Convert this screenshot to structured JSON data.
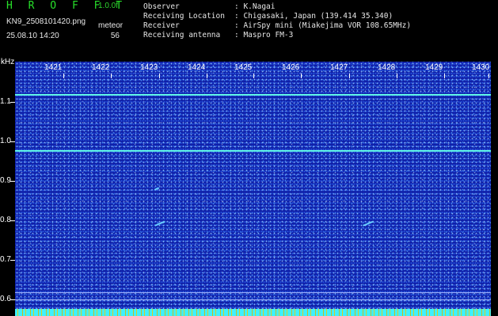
{
  "header": {
    "app_title": "H R O F F T",
    "version": "1.0.0f",
    "filename": "KN9_2508101420.png",
    "meteor_label": "meteor",
    "datetime": "25.08.10 14:20",
    "meteor_count": "56"
  },
  "info": {
    "observer_label": "Observer",
    "observer_value": ": K.Nagai",
    "location_label": "Receiving Location",
    "location_value": ": Chigasaki, Japan (139.414 35.340)",
    "receiver_label": "Receiver",
    "receiver_value": ": AirSpy mini (Miakejima VOR 108.65MHz)",
    "antenna_label": "Receiving antenna",
    "antenna_value": ": Maspro FM-3"
  },
  "spectrogram": {
    "y_unit": "kHz",
    "x_ticks": [
      "1421",
      "1422",
      "1423",
      "1424",
      "1425",
      "1426",
      "1427",
      "1428",
      "1429",
      "1430"
    ],
    "y_ticks": [
      "1.1",
      "1.0",
      "0.9",
      "0.8",
      "0.7",
      "0.6"
    ],
    "colors": {
      "background": "#1020a8",
      "carrier_line": "#5ff5e6",
      "bottom_band": "#3ff0ff",
      "title_green": "#27e02a"
    }
  }
}
